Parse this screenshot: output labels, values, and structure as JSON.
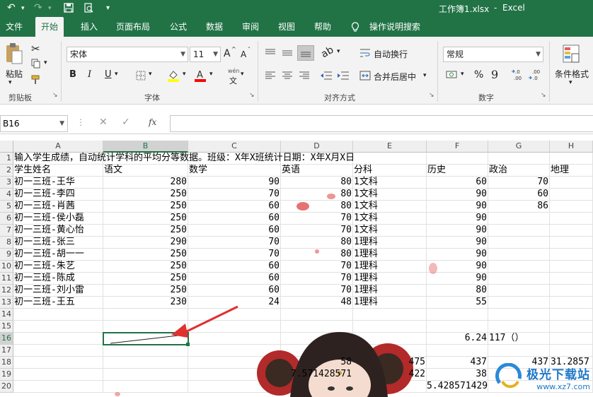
{
  "title": {
    "file": "工作簿1.xlsx",
    "separator": "-",
    "app": "Excel"
  },
  "tabs": [
    "文件",
    "开始",
    "插入",
    "页面布局",
    "公式",
    "数据",
    "审阅",
    "视图",
    "帮助"
  ],
  "active_tab": "开始",
  "tell_me": "操作说明搜索",
  "ribbon": {
    "clipboard": {
      "paste": "粘贴",
      "label": "剪贴板"
    },
    "font": {
      "name": "宋体",
      "size": "11",
      "label": "字体",
      "bold": "B",
      "italic": "I",
      "underline": "U",
      "grow": "A",
      "shrink": "A",
      "phonetic_top": "wén",
      "phonetic_bottom": "文"
    },
    "alignment": {
      "wrap": "自动换行",
      "merge": "合并后居中",
      "label": "对齐方式"
    },
    "number": {
      "format": "常规",
      "percent": "%",
      "comma": "9",
      "label": "数字"
    },
    "styles": {
      "conditional": "条件格式"
    }
  },
  "formula_bar": {
    "name_box": "B16",
    "fx": "fx",
    "value": ""
  },
  "columns": [
    "A",
    "B",
    "C",
    "D",
    "E",
    "F",
    "G",
    "H"
  ],
  "selected_column": "B",
  "selected_row": "16",
  "rows": [
    {
      "n": "1",
      "cells": [
        {
          "c": 0,
          "v": "输入学生成绩，自动统计学科的平均分等数据。班级：X年X班统计日期：X年X月X日",
          "a": "l"
        }
      ]
    },
    {
      "n": "2",
      "cells": [
        {
          "c": 0,
          "v": "学生姓名",
          "a": "l"
        },
        {
          "c": 1,
          "v": "语文",
          "a": "l"
        },
        {
          "c": 2,
          "v": "数学",
          "a": "l"
        },
        {
          "c": 3,
          "v": "英语",
          "a": "l"
        },
        {
          "c": 4,
          "v": "分科",
          "a": "l"
        },
        {
          "c": 5,
          "v": "历史",
          "a": "l"
        },
        {
          "c": 6,
          "v": "政治",
          "a": "l"
        },
        {
          "c": 7,
          "v": "地理",
          "a": "l"
        }
      ]
    },
    {
      "n": "3",
      "cells": [
        {
          "c": 0,
          "v": "初一三班-王华",
          "a": "l"
        },
        {
          "c": 1,
          "v": "280",
          "a": "r"
        },
        {
          "c": 2,
          "v": "90",
          "a": "r"
        },
        {
          "c": 3,
          "v": "80",
          "a": "r"
        },
        {
          "c": 4,
          "v": "1文科",
          "a": "l"
        },
        {
          "c": 5,
          "v": "60",
          "a": "r"
        },
        {
          "c": 6,
          "v": "70",
          "a": "r"
        }
      ]
    },
    {
      "n": "4",
      "cells": [
        {
          "c": 0,
          "v": "初一三班-李四",
          "a": "l"
        },
        {
          "c": 1,
          "v": "250",
          "a": "r"
        },
        {
          "c": 2,
          "v": "70",
          "a": "r"
        },
        {
          "c": 3,
          "v": "80",
          "a": "r"
        },
        {
          "c": 4,
          "v": "1文科",
          "a": "l"
        },
        {
          "c": 5,
          "v": "90",
          "a": "r"
        },
        {
          "c": 6,
          "v": "60",
          "a": "r"
        }
      ]
    },
    {
      "n": "5",
      "cells": [
        {
          "c": 0,
          "v": "初一三班-肖茜",
          "a": "l"
        },
        {
          "c": 1,
          "v": "250",
          "a": "r"
        },
        {
          "c": 2,
          "v": "60",
          "a": "r"
        },
        {
          "c": 3,
          "v": "80",
          "a": "r"
        },
        {
          "c": 4,
          "v": "1文科",
          "a": "l"
        },
        {
          "c": 5,
          "v": "90",
          "a": "r"
        },
        {
          "c": 6,
          "v": "86",
          "a": "r"
        }
      ]
    },
    {
      "n": "6",
      "cells": [
        {
          "c": 0,
          "v": "初一三班-侯小磊",
          "a": "l"
        },
        {
          "c": 1,
          "v": "250",
          "a": "r"
        },
        {
          "c": 2,
          "v": "60",
          "a": "r"
        },
        {
          "c": 3,
          "v": "70",
          "a": "r"
        },
        {
          "c": 4,
          "v": "1文科",
          "a": "l"
        },
        {
          "c": 5,
          "v": "90",
          "a": "r"
        }
      ]
    },
    {
      "n": "7",
      "cells": [
        {
          "c": 0,
          "v": "初一三班-黄心怡",
          "a": "l"
        },
        {
          "c": 1,
          "v": "250",
          "a": "r"
        },
        {
          "c": 2,
          "v": "60",
          "a": "r"
        },
        {
          "c": 3,
          "v": "70",
          "a": "r"
        },
        {
          "c": 4,
          "v": "1文科",
          "a": "l"
        },
        {
          "c": 5,
          "v": "90",
          "a": "r"
        }
      ]
    },
    {
      "n": "8",
      "cells": [
        {
          "c": 0,
          "v": "初一三班-张三",
          "a": "l"
        },
        {
          "c": 1,
          "v": "290",
          "a": "r"
        },
        {
          "c": 2,
          "v": "70",
          "a": "r"
        },
        {
          "c": 3,
          "v": "80",
          "a": "r"
        },
        {
          "c": 4,
          "v": "1理科",
          "a": "l"
        },
        {
          "c": 5,
          "v": "90",
          "a": "r"
        }
      ]
    },
    {
      "n": "9",
      "cells": [
        {
          "c": 0,
          "v": "初一三班-胡一一",
          "a": "l"
        },
        {
          "c": 1,
          "v": "250",
          "a": "r"
        },
        {
          "c": 2,
          "v": "70",
          "a": "r"
        },
        {
          "c": 3,
          "v": "80",
          "a": "r"
        },
        {
          "c": 4,
          "v": "1理科",
          "a": "l"
        },
        {
          "c": 5,
          "v": "90",
          "a": "r"
        }
      ]
    },
    {
      "n": "10",
      "cells": [
        {
          "c": 0,
          "v": "初一三班-朱艺",
          "a": "l"
        },
        {
          "c": 1,
          "v": "250",
          "a": "r"
        },
        {
          "c": 2,
          "v": "60",
          "a": "r"
        },
        {
          "c": 3,
          "v": "70",
          "a": "r"
        },
        {
          "c": 4,
          "v": "1理科",
          "a": "l"
        },
        {
          "c": 5,
          "v": "90",
          "a": "r"
        }
      ]
    },
    {
      "n": "11",
      "cells": [
        {
          "c": 0,
          "v": "初一三班-陈成",
          "a": "l"
        },
        {
          "c": 1,
          "v": "250",
          "a": "r"
        },
        {
          "c": 2,
          "v": "60",
          "a": "r"
        },
        {
          "c": 3,
          "v": "70",
          "a": "r"
        },
        {
          "c": 4,
          "v": "1理科",
          "a": "l"
        },
        {
          "c": 5,
          "v": "90",
          "a": "r"
        }
      ]
    },
    {
      "n": "12",
      "cells": [
        {
          "c": 0,
          "v": "初一三班-刘小雷",
          "a": "l"
        },
        {
          "c": 1,
          "v": "250",
          "a": "r"
        },
        {
          "c": 2,
          "v": "60",
          "a": "r"
        },
        {
          "c": 3,
          "v": "70",
          "a": "r"
        },
        {
          "c": 4,
          "v": "1理科",
          "a": "l"
        },
        {
          "c": 5,
          "v": "80",
          "a": "r"
        }
      ]
    },
    {
      "n": "13",
      "cells": [
        {
          "c": 0,
          "v": "初一三班-王五",
          "a": "l"
        },
        {
          "c": 1,
          "v": "230",
          "a": "r"
        },
        {
          "c": 2,
          "v": "24",
          "a": "r"
        },
        {
          "c": 3,
          "v": "48",
          "a": "r"
        },
        {
          "c": 4,
          "v": "1理科",
          "a": "l"
        },
        {
          "c": 5,
          "v": "55",
          "a": "r"
        }
      ]
    },
    {
      "n": "14",
      "cells": []
    },
    {
      "n": "15",
      "cells": []
    },
    {
      "n": "16",
      "cells": [
        {
          "c": 5,
          "v": "6.24",
          "a": "r"
        },
        {
          "c": 6,
          "v": "117（）",
          "a": "l"
        }
      ]
    },
    {
      "n": "17",
      "cells": []
    },
    {
      "n": "18",
      "cells": [
        {
          "c": 3,
          "v": "58",
          "a": "r"
        },
        {
          "c": 4,
          "v": "475",
          "a": "r"
        },
        {
          "c": 5,
          "v": "437",
          "a": "r"
        },
        {
          "c": 6,
          "v": "437",
          "a": "r"
        },
        {
          "c": 7,
          "v": "31.2857",
          "a": "l"
        }
      ]
    },
    {
      "n": "19",
      "cells": [
        {
          "c": 3,
          "v": "7.571428571",
          "a": "r"
        },
        {
          "c": 4,
          "v": "422",
          "a": "r"
        },
        {
          "c": 5,
          "v": "38",
          "a": "r"
        }
      ]
    },
    {
      "n": "20",
      "cells": [
        {
          "c": 5,
          "v": "5.428571429",
          "a": "r"
        }
      ]
    }
  ],
  "watermark": {
    "brand": "极光下载站",
    "url": "www.xz7.com"
  },
  "colors": {
    "excel_green": "#217346",
    "arrow_red": "#e03030"
  }
}
